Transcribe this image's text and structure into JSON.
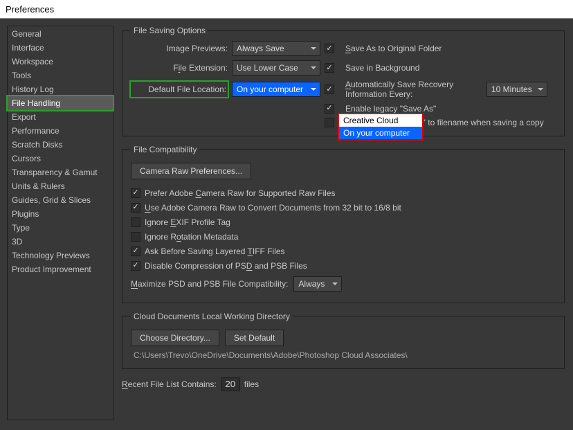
{
  "window": {
    "title": "Preferences"
  },
  "sidebar": {
    "items": [
      {
        "label": "General"
      },
      {
        "label": "Interface"
      },
      {
        "label": "Workspace"
      },
      {
        "label": "Tools"
      },
      {
        "label": "History Log"
      },
      {
        "label": "File Handling"
      },
      {
        "label": "Export"
      },
      {
        "label": "Performance"
      },
      {
        "label": "Scratch Disks"
      },
      {
        "label": "Cursors"
      },
      {
        "label": "Transparency & Gamut"
      },
      {
        "label": "Units & Rulers"
      },
      {
        "label": "Guides, Grid & Slices"
      },
      {
        "label": "Plugins"
      },
      {
        "label": "Type"
      },
      {
        "label": "3D"
      },
      {
        "label": "Technology Previews"
      },
      {
        "label": "Product Improvement"
      }
    ],
    "selected_index": 5
  },
  "file_saving": {
    "legend": "File Saving Options",
    "image_previews_label": "Image Previews:",
    "image_previews_value": "Always Save",
    "file_extension_label_pre": "F",
    "file_extension_label_u": "i",
    "file_extension_label_post": "le Extension:",
    "file_extension_value": "Use Lower Case",
    "default_location_label": "Default File Location:",
    "default_location_value": "On your computer",
    "options": [
      "Creative Cloud",
      "On your computer"
    ],
    "save_original_pre": "",
    "save_original_u": "S",
    "save_original_post": "ave As to Original Folder",
    "save_bg": "Save in Background",
    "auto_save_pre": "",
    "auto_save_u": "A",
    "auto_save_post": "utomatically Save Recovery Information Every:",
    "auto_save_interval": "10 Minutes",
    "legacy_saveas": "Enable legacy \"Save As\"",
    "no_copy": "Do not append \"copy\" to filename when saving a copy"
  },
  "file_compat": {
    "legend": "File Compatibility",
    "camera_raw_btn": "Camera Raw Preferences...",
    "prefer_acr_pre": "Prefer Adobe ",
    "prefer_acr_u": "C",
    "prefer_acr_post": "amera Raw for Supported Raw Files",
    "use_acr_pre": "",
    "use_acr_u": "U",
    "use_acr_post": "se Adobe Camera Raw to Convert Documents from 32 bit to 16/8 bit",
    "ignore_exif_pre": "Ignore ",
    "ignore_exif_u": "E",
    "ignore_exif_post": "XIF Profile Tag",
    "ignore_rot_pre": "Ignore R",
    "ignore_rot_u": "o",
    "ignore_rot_post": "tation Metadata",
    "ask_tiff_pre": "Ask Before Saving Layered ",
    "ask_tiff_u": "T",
    "ask_tiff_post": "IFF Files",
    "disable_comp_pre": "Disable Compression of PS",
    "disable_comp_u": "D",
    "disable_comp_post": " and PSB Files",
    "maximize_pre": "",
    "maximize_u": "M",
    "maximize_post": "aximize PSD and PSB File Compatibility:",
    "maximize_value": "Always"
  },
  "cloud_dir": {
    "legend": "Cloud Documents Local Working Directory",
    "choose_btn": "Choose Directory...",
    "default_btn": "Set Default",
    "path": "C:\\Users\\Trevo\\OneDrive\\Documents\\Adobe\\Photoshop Cloud Associates\\"
  },
  "recent": {
    "label_pre": "",
    "label_u": "R",
    "label_post": "ecent File List Contains:",
    "value": "20",
    "suffix": "files"
  }
}
